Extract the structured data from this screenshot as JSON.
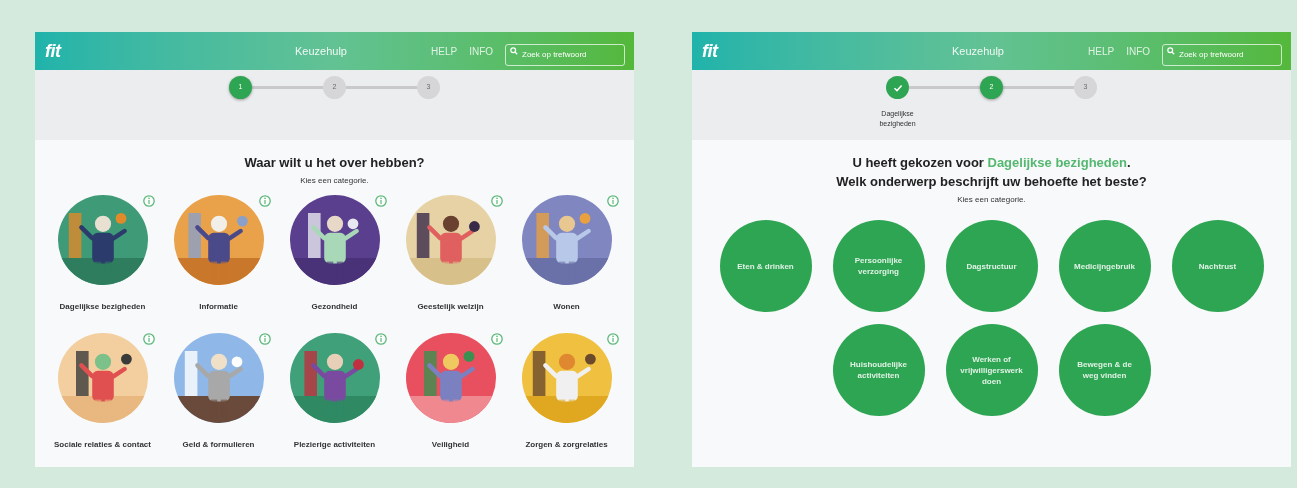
{
  "screens": [
    {
      "header": {
        "logo": "fit",
        "title": "Keuzehulp",
        "links": [
          "HELP",
          "INFO"
        ],
        "search": {
          "placeholder": "Zoek op trefwoord"
        }
      },
      "steps": [
        {
          "label": "1",
          "completed": false,
          "selected": true
        },
        {
          "label": "2",
          "completed": false,
          "selected": false
        },
        {
          "label": "3",
          "completed": false,
          "selected": false
        }
      ],
      "heading": {
        "text": "Waar wilt u het over hebben?"
      },
      "subtitle": "Kies een categorie.",
      "categories": [
        {
          "label": "Dagelijkse bezigheden"
        },
        {
          "label": "Informatie"
        },
        {
          "label": "Gezondheid"
        },
        {
          "label": "Geestelijk welzijn"
        },
        {
          "label": "Wonen"
        },
        {
          "label": "Sociale relaties & contact"
        },
        {
          "label": "Geld & formulieren"
        },
        {
          "label": "Plezierige activiteiten"
        },
        {
          "label": "Veiligheid"
        },
        {
          "label": "Zorgen & zorgrelaties"
        }
      ]
    },
    {
      "header": {
        "logo": "fit",
        "title": "Keuzehulp",
        "links": [
          "HELP",
          "INFO"
        ],
        "search": {
          "placeholder": "Zoek op trefwoord"
        }
      },
      "steps": [
        {
          "completed": true,
          "selected": false,
          "caption": "Dagelijkse bezigheden"
        },
        {
          "label": "2",
          "completed": false,
          "selected": true
        },
        {
          "label": "3",
          "completed": false,
          "selected": false
        }
      ],
      "heading": {
        "text": "U heeft gekozen voor ",
        "highlight": "Dagelijkse bezigheden",
        "after": "."
      },
      "question": "Welk onderwerp beschrijft uw behoefte het beste?",
      "subtitle": "Kies een categorie.",
      "topics": [
        {
          "label": "Eten & drinken"
        },
        {
          "label": "Persoonlijke verzorging"
        },
        {
          "label": "Dagstructuur"
        },
        {
          "label": "Medicijngebruik"
        },
        {
          "label": "Nachtrust"
        },
        {
          "label": "Huishoudelijke activiteiten"
        },
        {
          "label": "Werken of vrijwilligerswerk doen"
        },
        {
          "label": "Bewegen & de weg vinden"
        }
      ]
    }
  ]
}
